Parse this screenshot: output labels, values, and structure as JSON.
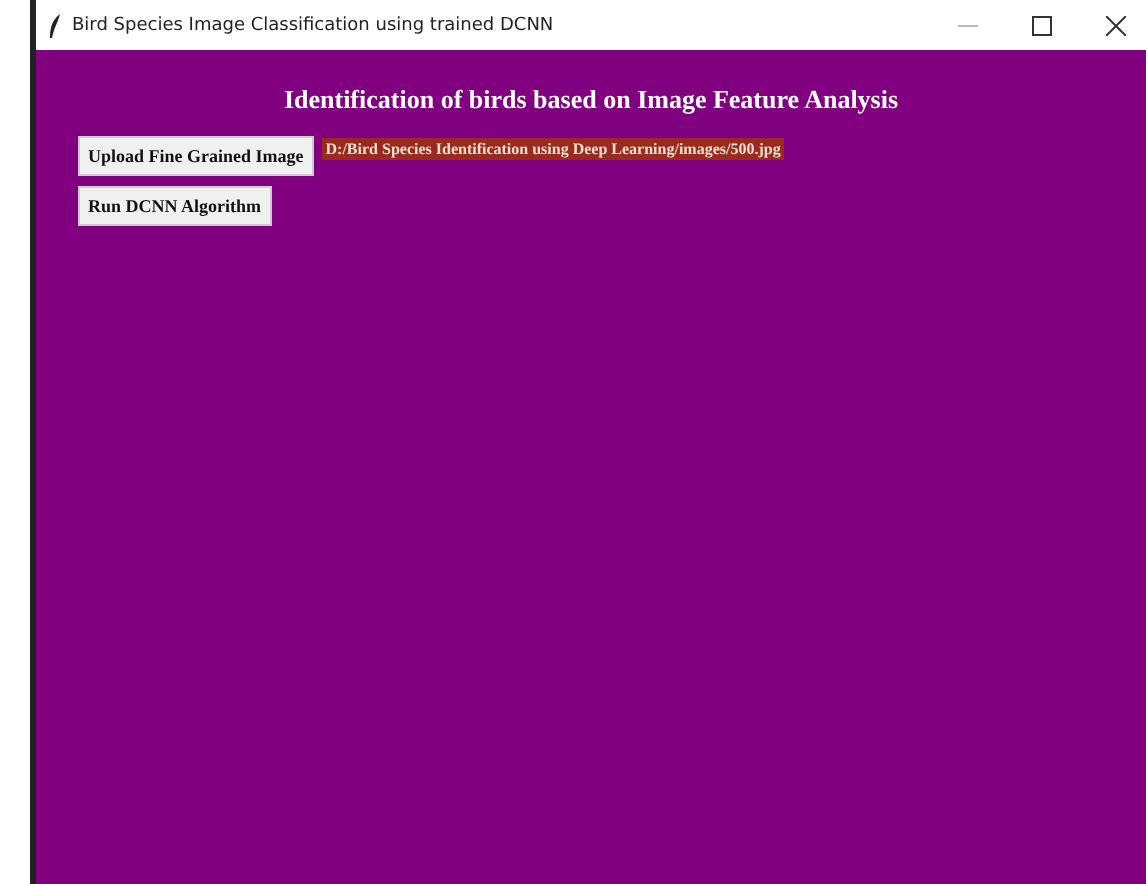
{
  "window": {
    "title": "Bird Species Image Classification using trained DCNN"
  },
  "heading": "Identification of birds based on Image Feature Analysis",
  "upload_button": "Upload Fine Grained Image",
  "path_label": "D:/Bird Species Identification using Deep Learning/images/500.jpg",
  "run_button": "Run DCNN Algorithm"
}
